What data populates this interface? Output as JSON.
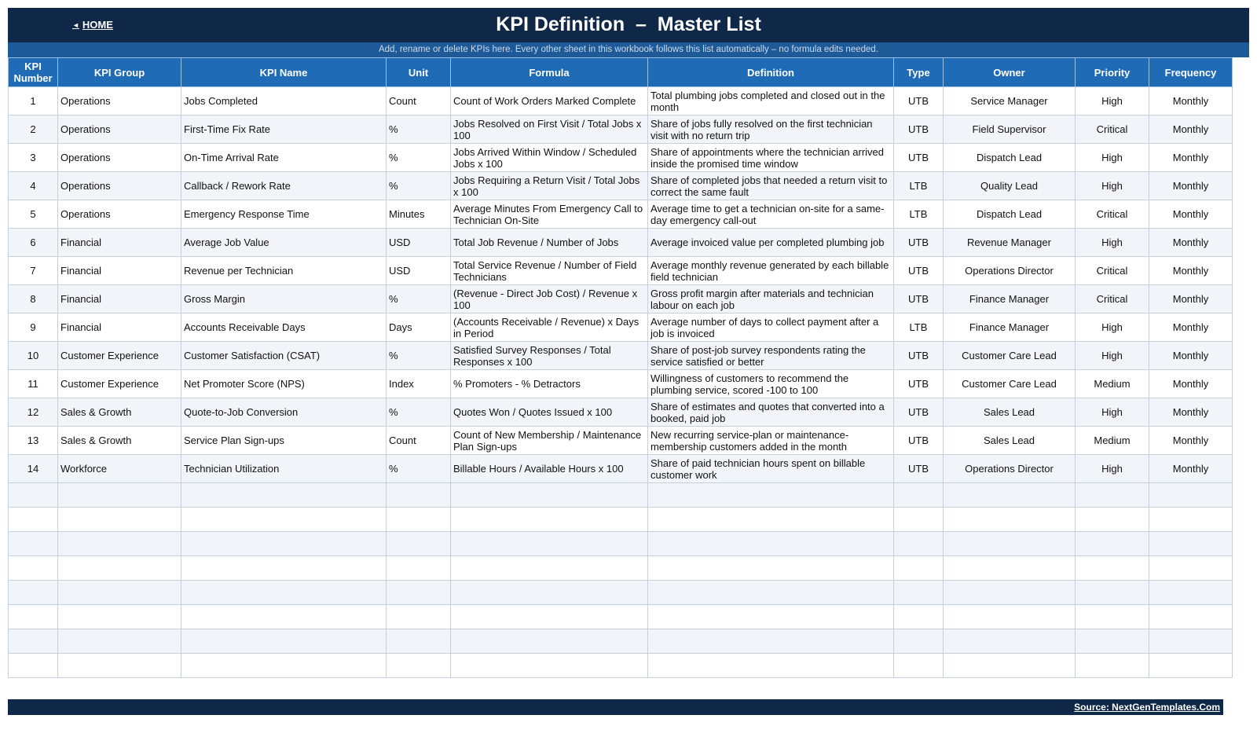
{
  "header": {
    "home_label": "HOME",
    "title": "KPI Definition  –  Master List",
    "subtitle": "Add, rename or delete KPIs here. Every other sheet in this workbook follows this list automatically – no formula edits needed."
  },
  "table": {
    "columns": [
      "KPI Number",
      "KPI Group",
      "KPI Name",
      "Unit",
      "Formula",
      "Definition",
      "Type",
      "Owner",
      "Priority",
      "Frequency"
    ],
    "rows": [
      [
        "1",
        "Operations",
        "Jobs Completed",
        "Count",
        "Count of Work Orders Marked Complete",
        "Total plumbing jobs completed and closed out in the month",
        "UTB",
        "Service Manager",
        "High",
        "Monthly"
      ],
      [
        "2",
        "Operations",
        "First-Time Fix Rate",
        "%",
        "Jobs Resolved on First Visit / Total Jobs x 100",
        "Share of jobs fully resolved on the first technician visit with no return trip",
        "UTB",
        "Field Supervisor",
        "Critical",
        "Monthly"
      ],
      [
        "3",
        "Operations",
        "On-Time Arrival Rate",
        "%",
        "Jobs Arrived Within Window / Scheduled Jobs x 100",
        "Share of appointments where the technician arrived inside the promised time window",
        "UTB",
        "Dispatch Lead",
        "High",
        "Monthly"
      ],
      [
        "4",
        "Operations",
        "Callback / Rework Rate",
        "%",
        "Jobs Requiring a Return Visit / Total Jobs x 100",
        "Share of completed jobs that needed a return visit to correct the same fault",
        "LTB",
        "Quality Lead",
        "High",
        "Monthly"
      ],
      [
        "5",
        "Operations",
        "Emergency Response Time",
        "Minutes",
        "Average Minutes From Emergency Call to Technician On-Site",
        "Average time to get a technician on-site for a same-day emergency call-out",
        "LTB",
        "Dispatch Lead",
        "Critical",
        "Monthly"
      ],
      [
        "6",
        "Financial",
        "Average Job Value",
        "USD",
        "Total Job Revenue / Number of Jobs",
        "Average invoiced value per completed plumbing job",
        "UTB",
        "Revenue Manager",
        "High",
        "Monthly"
      ],
      [
        "7",
        "Financial",
        "Revenue per Technician",
        "USD",
        "Total Service Revenue / Number of Field Technicians",
        "Average monthly revenue generated by each billable field technician",
        "UTB",
        "Operations Director",
        "Critical",
        "Monthly"
      ],
      [
        "8",
        "Financial",
        "Gross Margin",
        "%",
        "(Revenue - Direct Job Cost) / Revenue x 100",
        "Gross profit margin after materials and technician labour on each job",
        "UTB",
        "Finance Manager",
        "Critical",
        "Monthly"
      ],
      [
        "9",
        "Financial",
        "Accounts Receivable Days",
        "Days",
        "(Accounts Receivable / Revenue) x Days in Period",
        "Average number of days to collect payment after a job is invoiced",
        "LTB",
        "Finance Manager",
        "High",
        "Monthly"
      ],
      [
        "10",
        "Customer Experience",
        "Customer Satisfaction (CSAT)",
        "%",
        "Satisfied Survey Responses / Total Responses x 100",
        "Share of post-job survey respondents rating the service satisfied or better",
        "UTB",
        "Customer Care Lead",
        "High",
        "Monthly"
      ],
      [
        "11",
        "Customer Experience",
        "Net Promoter Score (NPS)",
        "Index",
        "% Promoters - % Detractors",
        "Willingness of customers to recommend the plumbing service, scored -100 to 100",
        "UTB",
        "Customer Care Lead",
        "Medium",
        "Monthly"
      ],
      [
        "12",
        "Sales & Growth",
        "Quote-to-Job Conversion",
        "%",
        "Quotes Won / Quotes Issued x 100",
        "Share of estimates and quotes that converted into a booked, paid job",
        "UTB",
        "Sales Lead",
        "High",
        "Monthly"
      ],
      [
        "13",
        "Sales & Growth",
        "Service Plan Sign-ups",
        "Count",
        "Count of New Membership / Maintenance Plan Sign-ups",
        "New recurring service-plan or maintenance-membership customers added in the month",
        "UTB",
        "Sales Lead",
        "Medium",
        "Monthly"
      ],
      [
        "14",
        "Workforce",
        "Technician Utilization",
        "%",
        "Billable Hours / Available Hours x 100",
        "Share of paid technician hours spent on billable customer work",
        "UTB",
        "Operations Director",
        "High",
        "Monthly"
      ]
    ],
    "empty_rows": 8
  },
  "footer": {
    "source_label": "Source: NextGenTemplates.Com"
  }
}
